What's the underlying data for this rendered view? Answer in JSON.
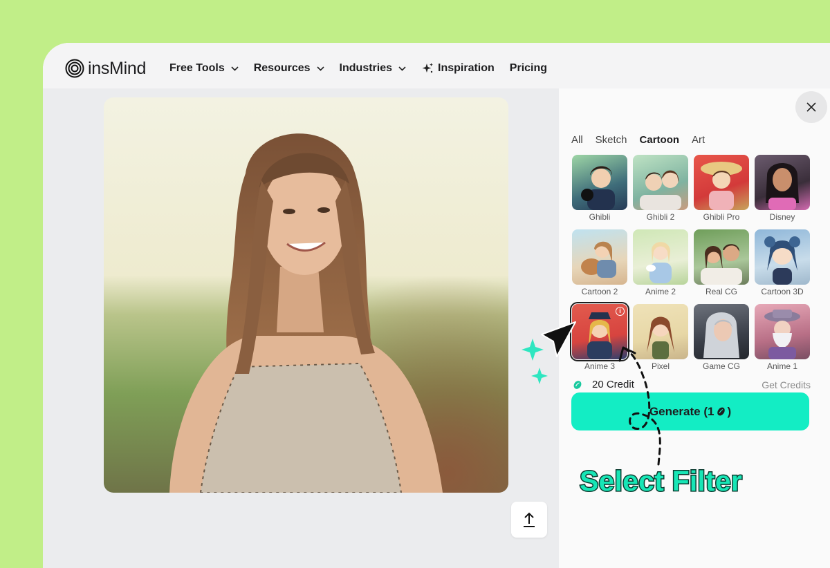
{
  "brand": {
    "name": "insMind"
  },
  "nav": {
    "free_tools": "Free Tools",
    "resources": "Resources",
    "industries": "Industries",
    "inspiration": "Inspiration",
    "pricing": "Pricing"
  },
  "filters": {
    "tabs": [
      {
        "label": "All",
        "active": false
      },
      {
        "label": "Sketch",
        "active": false
      },
      {
        "label": "Cartoon",
        "active": true
      },
      {
        "label": "Art",
        "active": false
      }
    ],
    "styles": [
      {
        "label": "Ghibli"
      },
      {
        "label": "Ghibli 2"
      },
      {
        "label": "Ghibli Pro"
      },
      {
        "label": "Disney"
      },
      {
        "label": "Cartoon 2"
      },
      {
        "label": "Anime 2"
      },
      {
        "label": "Real CG"
      },
      {
        "label": "Cartoon 3D"
      },
      {
        "label": "Anime 3",
        "selected": true
      },
      {
        "label": "Pixel"
      },
      {
        "label": "Game CG"
      },
      {
        "label": "Anime 1"
      }
    ],
    "selected_style": "Anime 3"
  },
  "credits": {
    "amount": "20 Credit",
    "get_label": "Get Credits"
  },
  "generate": {
    "label": "Generate (1",
    "suffix": ")"
  },
  "annotation": {
    "text": "Select Filter"
  },
  "colors": {
    "page_background": "#c1ee88",
    "accent": "#13edc4",
    "annotation_text": "#17e6b6"
  }
}
